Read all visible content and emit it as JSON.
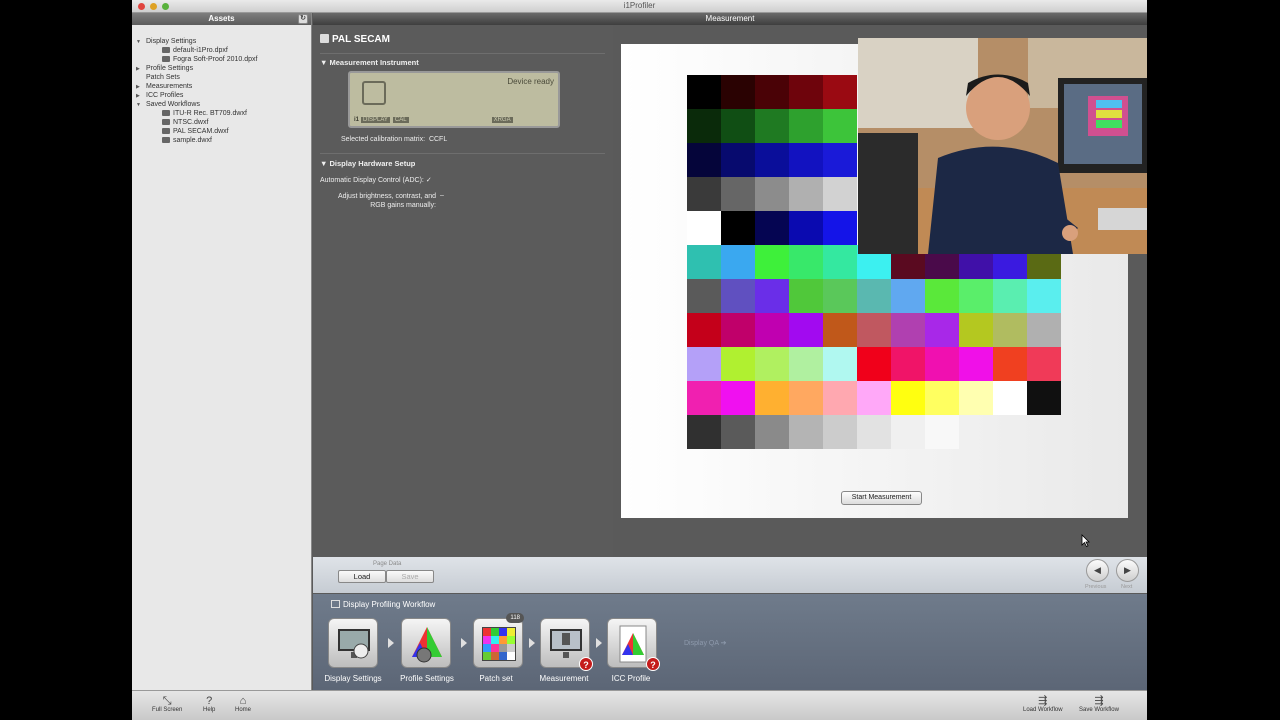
{
  "window": {
    "title": "i1Profiler"
  },
  "sidebar": {
    "header": "Assets",
    "tree": [
      {
        "label": "Display Settings",
        "level": 0,
        "expanded": true
      },
      {
        "label": "default-i1Pro.dpxf",
        "level": 1
      },
      {
        "label": "Fogra Soft-Proof 2010.dpxf",
        "level": 1
      },
      {
        "label": "Profile Settings",
        "level": 0,
        "expanded": false
      },
      {
        "label": "Patch Sets",
        "level": 0
      },
      {
        "label": "Measurements",
        "level": 0,
        "expanded": false
      },
      {
        "label": "ICC Profiles",
        "level": 0,
        "expanded": false
      },
      {
        "label": "Saved Workflows",
        "level": 0,
        "expanded": true
      },
      {
        "label": "ITU-R Rec. BT709.dwxf",
        "level": 1
      },
      {
        "label": "NTSC.dwxf",
        "level": 1
      },
      {
        "label": "PAL SECAM.dwxf",
        "level": 1
      },
      {
        "label": "sample.dwxf",
        "level": 1
      }
    ]
  },
  "main": {
    "header": "Measurement",
    "panel_title": "PAL SECAM",
    "instrument": {
      "heading": "Measurement Instrument",
      "status": "Device ready",
      "lcd_tags": [
        "DISPLAY",
        "CAL",
        "XRGA"
      ],
      "lcd_brand": "i1",
      "calibration_label": "Selected calibration matrix:",
      "calibration_value": "CCFL"
    },
    "hardware": {
      "heading": "Display Hardware Setup",
      "adc_label": "Automatic Display Control (ADC):",
      "adc_checked": true,
      "manual_label_1": "Adjust brightness, contrast, and",
      "manual_label_2": "RGB gains manually:",
      "manual_checked": false
    },
    "start_button": "Start Measurement",
    "patches": [
      [
        "#000000",
        "#2a0202",
        "#4a0206",
        "#6e040c",
        "#9a0a12"
      ],
      [
        "#0a2a0a",
        "#104e14",
        "#1f7a22",
        "#2ea12e",
        "#3dc43a"
      ],
      [
        "#05053a",
        "#070a6e",
        "#0a0e9a",
        "#1212c0",
        "#1a1ad8"
      ],
      [
        "#3a3a3a",
        "#666666",
        "#8c8c8c",
        "#b0b0b0",
        "#d2d2d2"
      ],
      [
        "#ffffff",
        "#000000",
        "#050552",
        "#0a0ab0",
        "#1414e8"
      ],
      [
        "#2fc0b0",
        "#3aa8f0",
        "#3ef03a",
        "#38e86a",
        "#34e8a0",
        "#3cf0f0",
        "#5a0a20",
        "#4a0a4a",
        "#4010a8",
        "#3a1ae0",
        "#5a6a14"
      ],
      [
        "#5a5a5a",
        "#6050c0",
        "#6a2ee8",
        "#50c83a",
        "#5ac85a",
        "#5ab8b0",
        "#60a8f0",
        "#5ae83a",
        "#5aee6a",
        "#5aeeb0",
        "#5aeeee"
      ],
      [
        "#c4001a",
        "#c0006a",
        "#c000b0",
        "#a20af0",
        "#c0581a",
        "#c05860",
        "#b040b0",
        "#a828e8",
        "#b4c820",
        "#b0bc60",
        "#b0b0b0"
      ],
      [
        "#b4a0f8",
        "#b0f030",
        "#b0f060",
        "#b0f0a0",
        "#b0f8f0",
        "#f0001a",
        "#f01468",
        "#f010b0",
        "#f010e8",
        "#f04020",
        "#f03a58"
      ],
      [
        "#f020b0",
        "#f010f0",
        "#ffb030",
        "#ffa860",
        "#ffa8b0",
        "#ffa8f8",
        "#ffff10",
        "#ffff60",
        "#ffffb0",
        "#ffffff",
        "#101010"
      ],
      [
        "#303030",
        "#5a5a5a",
        "#8a8a8a",
        "#b4b4b4",
        "#cccccc",
        "#e2e2e2",
        "#f0f0f0",
        "#f8f8f8"
      ]
    ]
  },
  "page_bar": {
    "label": "Page Data",
    "load": "Load",
    "save": "Save",
    "previous": "Previous",
    "next": "Next"
  },
  "workflow": {
    "title": "Display Profiling Workflow",
    "steps": [
      {
        "label": "Display Settings"
      },
      {
        "label": "Profile Settings"
      },
      {
        "label": "Patch set",
        "count": "118"
      },
      {
        "label": "Measurement",
        "warning": "?"
      },
      {
        "label": "ICC Profile",
        "warning": "?"
      }
    ],
    "qa": "Display QA"
  },
  "toolbar": {
    "full_screen": "Full Screen",
    "help": "Help",
    "home": "Home",
    "load_workflow": "Load Workflow",
    "save_workflow": "Save Workflow"
  }
}
